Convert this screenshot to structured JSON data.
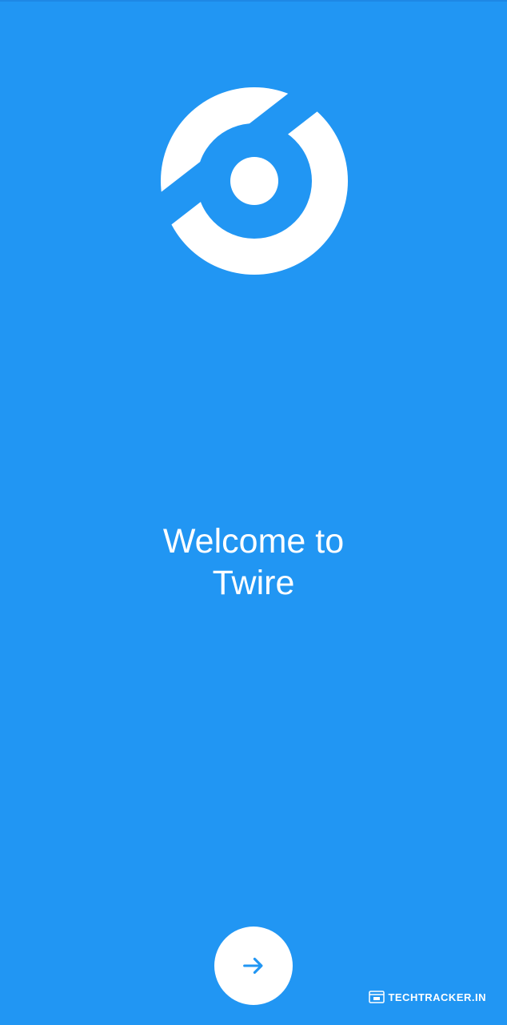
{
  "welcome": {
    "line1": "Welcome to",
    "line2": "Twire"
  },
  "next_button": {
    "icon": "arrow-right-icon"
  },
  "watermark": {
    "text": "TECHTRACKER.IN"
  },
  "colors": {
    "background": "#2196F3",
    "foreground": "#FFFFFF",
    "accent": "#2196F3"
  }
}
